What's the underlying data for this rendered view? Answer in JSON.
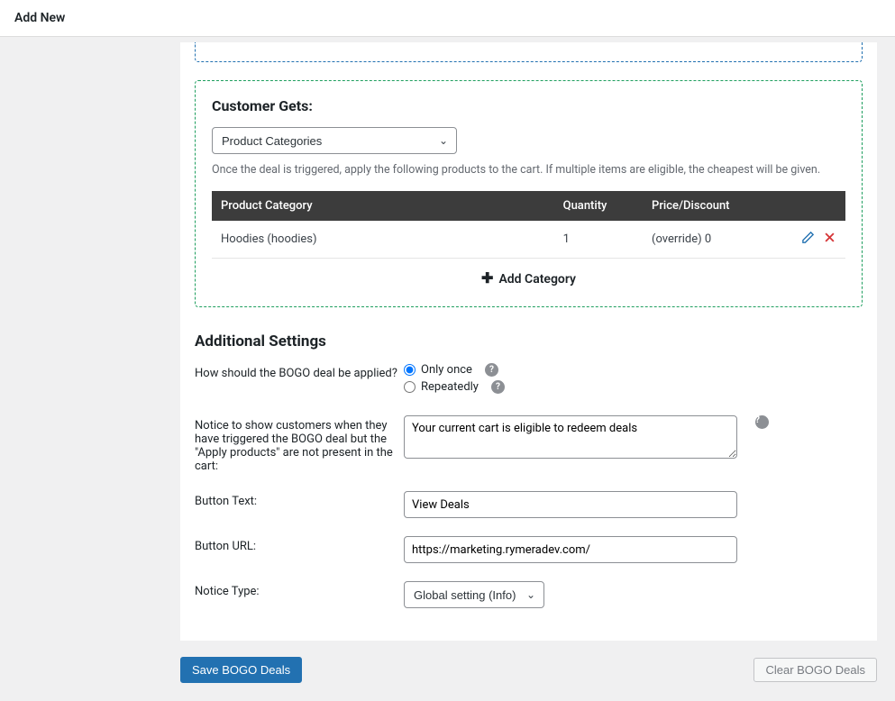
{
  "topbar": {
    "title": "Add New"
  },
  "customer_gets": {
    "title": "Customer Gets:",
    "selector_value": "Product Categories",
    "help": "Once the deal is triggered, apply the following products to the cart. If multiple items are eligible, the cheapest will be given.",
    "columns": {
      "category": "Product Category",
      "quantity": "Quantity",
      "price": "Price/Discount"
    },
    "rows": [
      {
        "category": "Hoodies (hoodies)",
        "quantity": "1",
        "price": "(override) 0"
      }
    ],
    "add_label": "Add Category"
  },
  "additional": {
    "title": "Additional Settings",
    "apply_label": "How should the BOGO deal be applied?",
    "apply_options": {
      "once": "Only once",
      "repeatedly": "Repeatedly"
    },
    "notice_label": "Notice to show customers when they have triggered the BOGO deal but the \"Apply products\" are not present in the cart:",
    "notice_value": "Your current cart is eligible to redeem deals",
    "button_text_label": "Button Text:",
    "button_text_value": "View Deals",
    "button_url_label": "Button URL:",
    "button_url_value": "https://marketing.rymeradev.com/",
    "notice_type_label": "Notice Type:",
    "notice_type_value": "Global setting (Info)"
  },
  "footer": {
    "save": "Save BOGO Deals",
    "clear": "Clear BOGO Deals"
  }
}
